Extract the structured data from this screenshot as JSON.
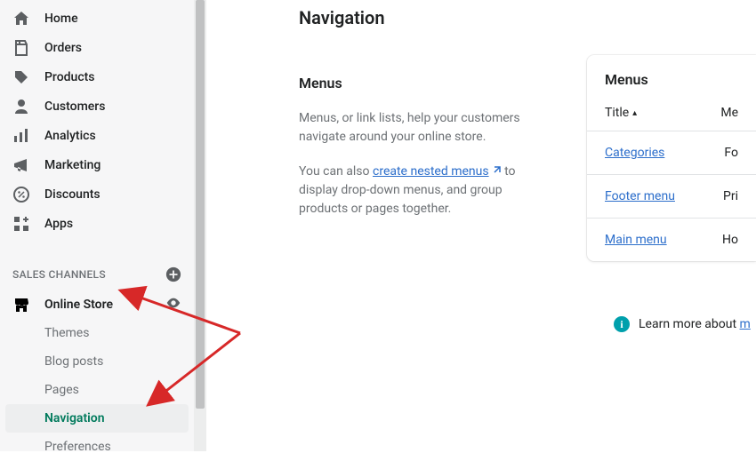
{
  "sidebar": {
    "items": [
      {
        "label": "Home"
      },
      {
        "label": "Orders"
      },
      {
        "label": "Products"
      },
      {
        "label": "Customers"
      },
      {
        "label": "Analytics"
      },
      {
        "label": "Marketing"
      },
      {
        "label": "Discounts"
      },
      {
        "label": "Apps"
      }
    ],
    "section_label": "SALES CHANNELS",
    "channel": {
      "label": "Online Store"
    },
    "sub_items": [
      {
        "label": "Themes"
      },
      {
        "label": "Blog posts"
      },
      {
        "label": "Pages"
      },
      {
        "label": "Navigation"
      },
      {
        "label": "Preferences"
      }
    ]
  },
  "main": {
    "title": "Navigation",
    "menus_heading": "Menus",
    "desc1": "Menus, or link lists, help your customers navigate around your online store.",
    "desc2_a": "You can also ",
    "desc2_link": "create nested menus",
    "desc2_b": " to display drop-down menus, and group products or pages together."
  },
  "card": {
    "heading": "Menus",
    "col_title": "Title",
    "col_items": "Me",
    "rows": [
      {
        "title": "Categories",
        "items": "Fo"
      },
      {
        "title": "Footer menu",
        "items": "Pri"
      },
      {
        "title": "Main menu",
        "items": "Ho"
      }
    ]
  },
  "learn_more": {
    "prefix": "Learn more about ",
    "link": "m"
  }
}
